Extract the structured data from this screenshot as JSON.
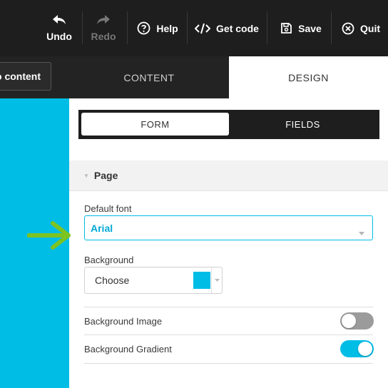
{
  "toolbar": {
    "undo_label": "Undo",
    "redo_label": "Redo",
    "help_label": "Help",
    "get_code_label": "Get code",
    "save_label": "Save",
    "quit_label": "Quit"
  },
  "left": {
    "to_content_label": "o content"
  },
  "tabs": {
    "content_label": "CONTENT",
    "design_label": "DESIGN",
    "active": "DESIGN"
  },
  "subtabs": {
    "form_label": "FORM",
    "fields_label": "FIELDS",
    "active": "FORM"
  },
  "section": {
    "title": "Page"
  },
  "fields": {
    "default_font_label": "Default font",
    "default_font_value": "Arial",
    "background_label": "Background",
    "background_choose": "Choose",
    "background_color": "#00bde6",
    "background_image_label": "Background Image",
    "background_image_enabled": false,
    "background_gradient_label": "Background Gradient",
    "background_gradient_enabled": true
  },
  "colors": {
    "accent": "#00bde6",
    "arrow": "#7dc321",
    "toolbar_bg": "#1e1e1e"
  },
  "icons": {
    "undo": "undo-icon",
    "redo": "redo-icon",
    "help": "help-icon",
    "code": "code-icon",
    "save": "save-icon",
    "quit": "close-circle-icon"
  }
}
